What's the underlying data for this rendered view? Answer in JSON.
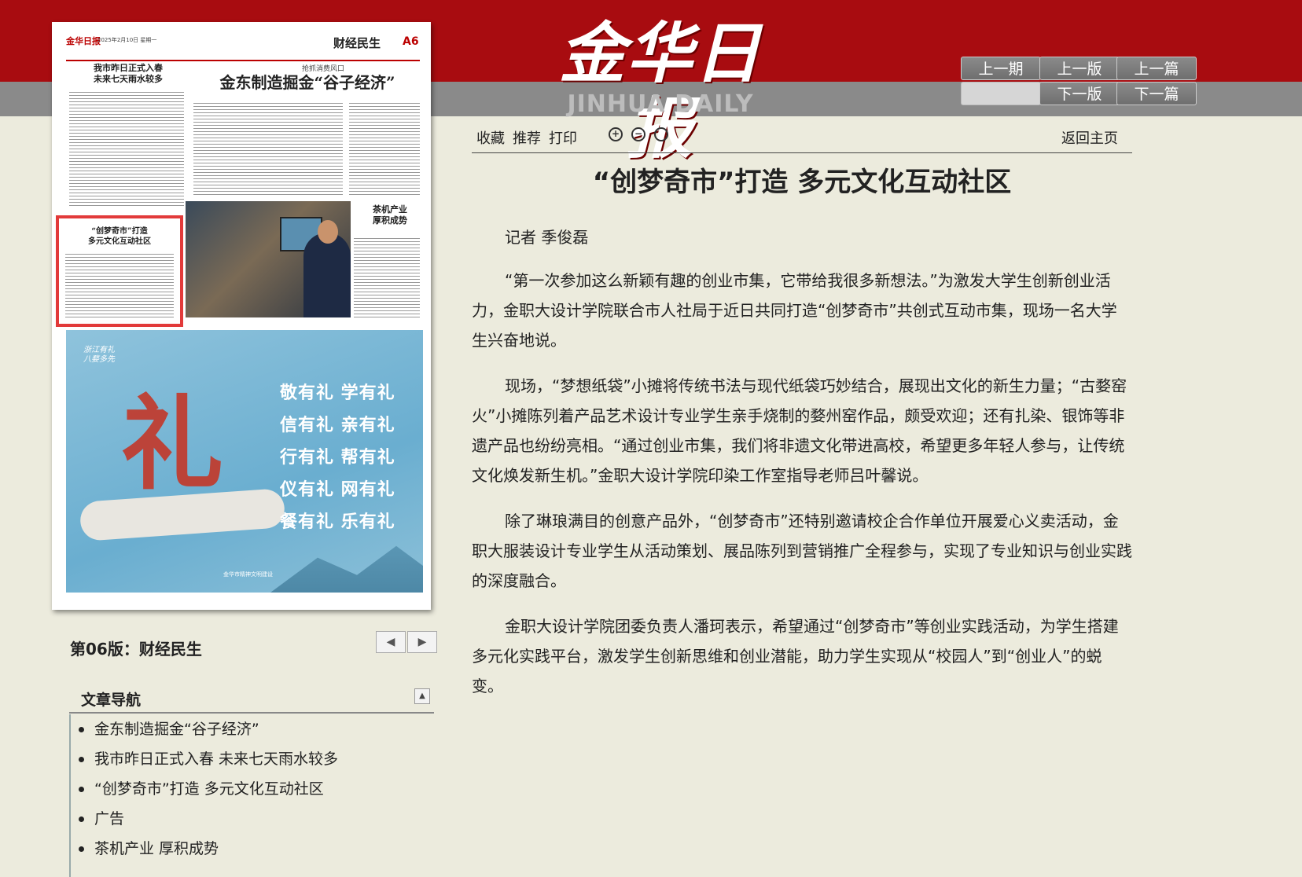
{
  "brand": {
    "name_cn": "金华日报",
    "name_en": "JINHUA DAILY"
  },
  "nav_buttons": {
    "prev_issue": "上一期",
    "prev_page": "上一版",
    "prev_article": "上一篇",
    "next_page": "下一版",
    "next_article": "下一篇"
  },
  "thumbnail": {
    "brand": "金华日报",
    "date_line": "2025年2月10日 星期一",
    "section": "财经民生",
    "page_no": "A6",
    "kicker": "抢抓消费风口",
    "headline_main": "金东制造掘金“谷子经济”",
    "headline_left": "我市昨日正式入春\n未来七天雨水较多",
    "highlight_title": "“创梦奇市”打造\n多元文化互动社区",
    "side_title": "茶机产业\n厚积成势",
    "ad": {
      "seal": "浙江有礼\n八婺多先",
      "big_char": "礼",
      "rows": [
        "敬有礼 学有礼",
        "信有礼 亲有礼",
        "行有礼 帮有礼",
        "仪有礼 网有礼",
        "餐有礼 乐有礼"
      ],
      "footer": "金华市精神文明建设"
    }
  },
  "edition_title": "第06版：财经民生",
  "pager": {
    "prev": "◀",
    "next": "▶"
  },
  "article_nav": {
    "title": "文章导航",
    "toggle": "▲",
    "items": [
      "金东制造掘金“谷子经济”",
      "我市昨日正式入春 未来七天雨水较多",
      "“创梦奇市”打造 多元文化互动社区",
      "广告",
      "茶机产业 厚积成势"
    ]
  },
  "toolbar": {
    "favorite": "收藏",
    "recommend": "推荐",
    "print": "打印",
    "zoom_in": "+",
    "zoom_out": "−",
    "zoom_reset": "○",
    "home": "返回主页"
  },
  "article": {
    "title": "“创梦奇市”打造 多元文化互动社区",
    "byline": "记者 季俊磊",
    "paragraphs": [
      "“第一次参加这么新颖有趣的创业市集，它带给我很多新想法。”为激发大学生创新创业活力，金职大设计学院联合市人社局于近日共同打造“创梦奇市”共创式互动市集，现场一名大学生兴奋地说。",
      "现场，“梦想纸袋”小摊将传统书法与现代纸袋巧妙结合，展现出文化的新生力量；“古婺窑火”小摊陈列着产品艺术设计专业学生亲手烧制的婺州窑作品，颇受欢迎；还有扎染、银饰等非遗产品也纷纷亮相。“通过创业市集，我们将非遗文化带进高校，希望更多年轻人参与，让传统文化焕发新生机。”金职大设计学院印染工作室指导老师吕叶馨说。",
      "除了琳琅满目的创意产品外，“创梦奇市”还特别邀请校企合作单位开展爱心义卖活动，金职大服装设计专业学生从活动策划、展品陈列到营销推广全程参与，实现了专业知识与创业实践的深度融合。",
      "金职大设计学院团委负责人潘珂表示，希望通过“创梦奇市”等创业实践活动，为学生搭建多元化实践平台，激发学生创新思维和创业潜能，助力学生实现从“校园人”到“创业人”的蜕变。"
    ]
  }
}
